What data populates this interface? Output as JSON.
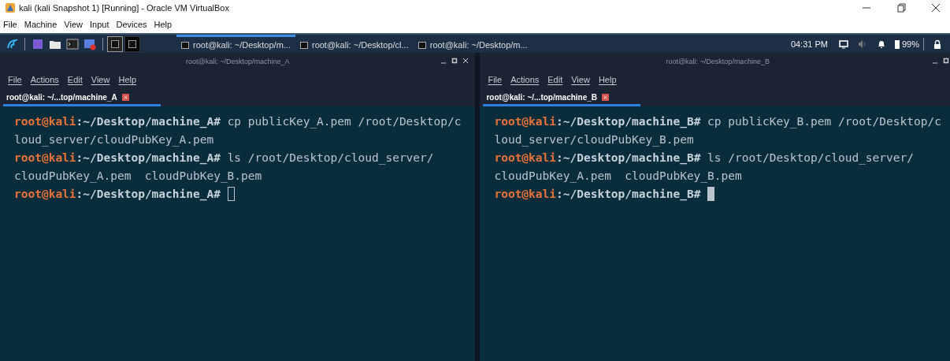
{
  "window": {
    "title": "kali (kali Snapshot 1) [Running] - Oracle VM VirtualBox"
  },
  "menu": [
    "File",
    "Machine",
    "View",
    "Input",
    "Devices",
    "Help"
  ],
  "panel": {
    "tasks": [
      {
        "label": "root@kali: ~/Desktop/m...",
        "selected": true
      },
      {
        "label": "root@kali: ~/Desktop/cl...",
        "selected": false
      },
      {
        "label": "root@kali: ~/Desktop/m...",
        "selected": false
      }
    ],
    "workspaces": [
      {
        "selected": true
      },
      {
        "selected": false
      }
    ],
    "clock": "04:31 PM",
    "battery": "99%"
  },
  "terminals": [
    {
      "title": "root@kali: ~/Desktop/machine_A",
      "closable": true,
      "focused": false,
      "menu": [
        "File",
        "Actions",
        "Edit",
        "View",
        "Help"
      ],
      "tab": "root@kali: ~/...top/machine_A",
      "lines": [
        {
          "kind": "prompt",
          "user": "root@kali",
          "path": ":~/Desktop/machine_A#",
          "command": " cp publicKey_A.pem /root/Desktop/c"
        },
        {
          "kind": "output",
          "text": "loud_server/cloudPubKey_A.pem"
        },
        {
          "kind": "prompt",
          "user": "root@kali",
          "path": ":~/Desktop/machine_A#",
          "command": " ls /root/Desktop/cloud_server/"
        },
        {
          "kind": "output",
          "text": "cloudPubKey_A.pem  cloudPubKey_B.pem"
        },
        {
          "kind": "prompt",
          "user": "root@kali",
          "path": ":~/Desktop/machine_A#",
          "cursor": true
        }
      ]
    },
    {
      "title": "root@kali: ~/Desktop/machine_B",
      "closable": false,
      "focused": true,
      "menu": [
        "File",
        "Actions",
        "Edit",
        "View",
        "Help"
      ],
      "tab": "root@kali: ~/...top/machine_B",
      "lines": [
        {
          "kind": "prompt",
          "user": "root@kali",
          "path": ":~/Desktop/machine_B#",
          "command": " cp publicKey_B.pem /root/Desktop/c"
        },
        {
          "kind": "output",
          "text": "loud_server/cloudPubKey_B.pem"
        },
        {
          "kind": "prompt",
          "user": "root@kali",
          "path": ":~/Desktop/machine_B#",
          "command": " ls /root/Desktop/cloud_server/"
        },
        {
          "kind": "output",
          "text": "cloudPubKey_A.pem  cloudPubKey_B.pem"
        },
        {
          "kind": "prompt",
          "user": "root@kali",
          "path": ":~/Desktop/machine_B#",
          "cursor": true
        }
      ]
    }
  ]
}
